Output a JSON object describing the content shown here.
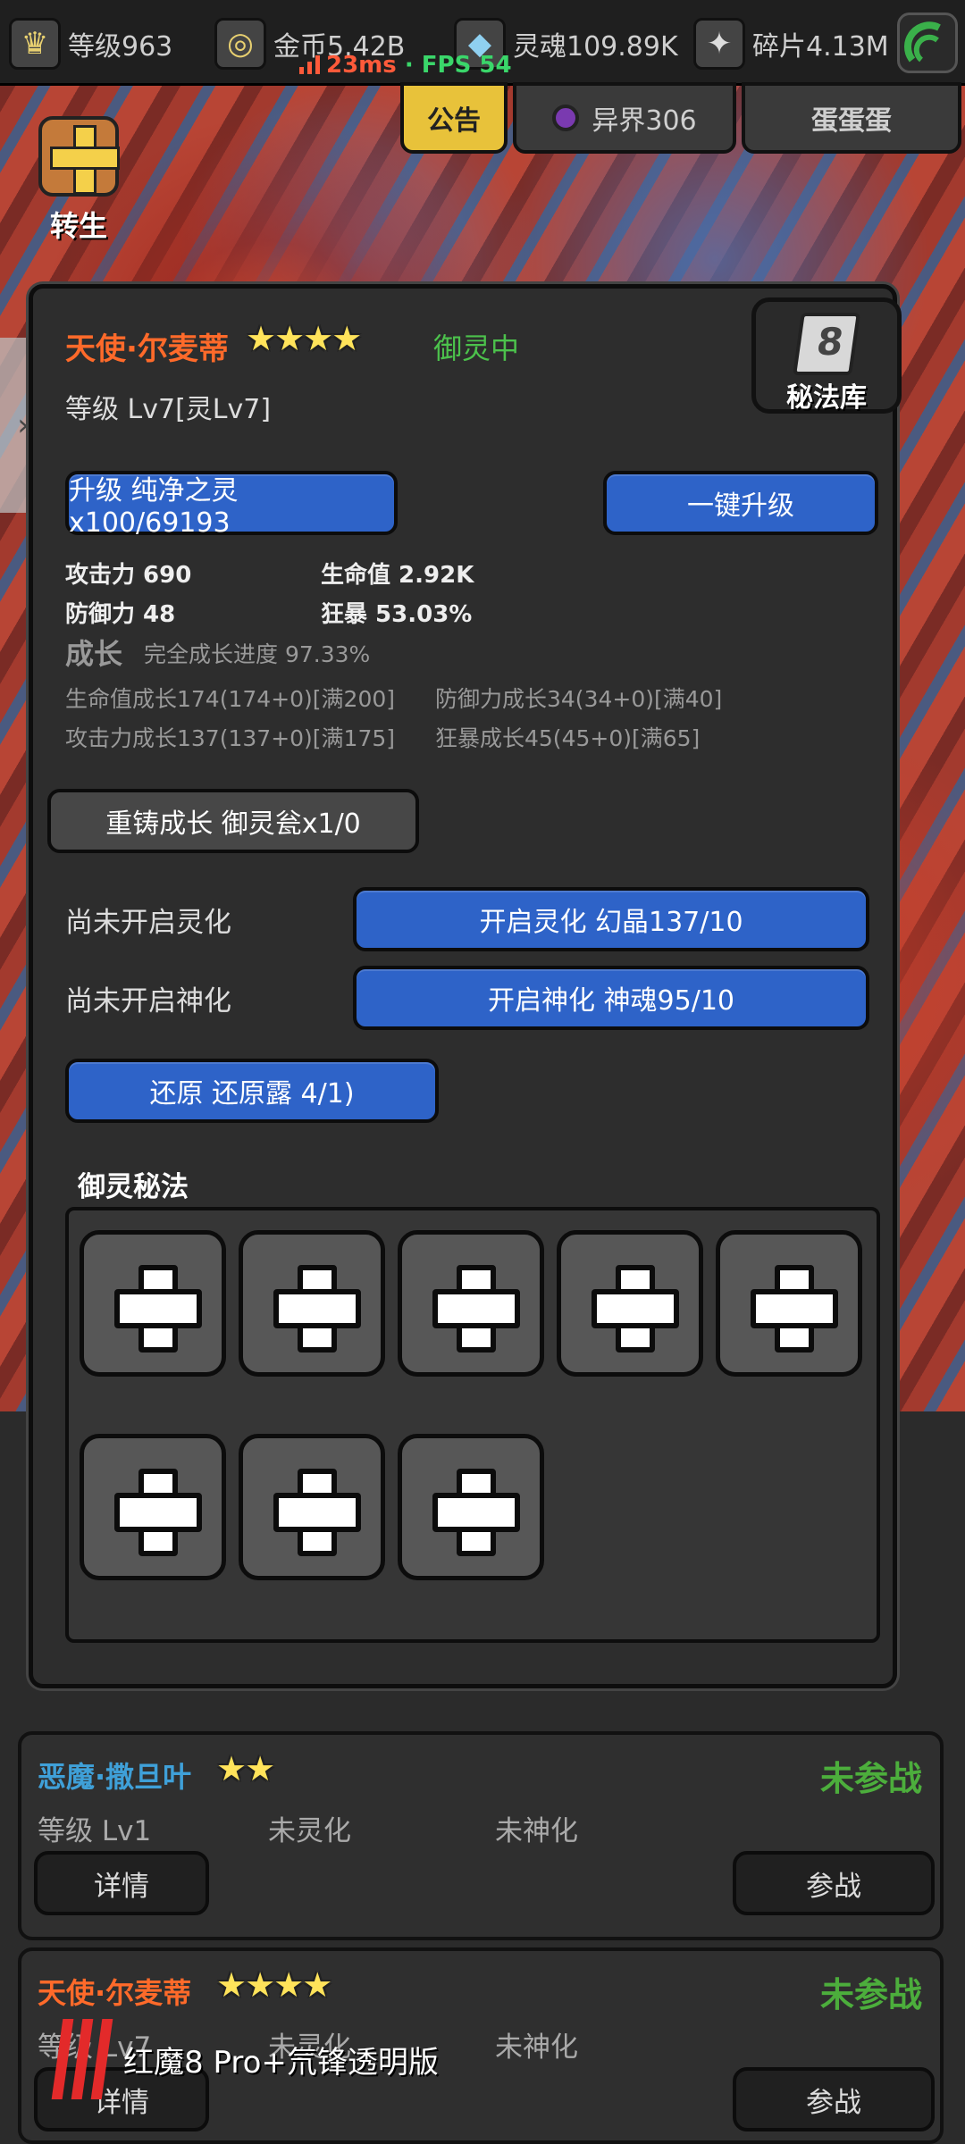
{
  "topbar": {
    "level": "等级963",
    "gold": "金币5.42B",
    "soul": "灵魂109.89K",
    "shard": "碎片4.13M",
    "latency": "23ms",
    "fps_sep": "·",
    "fps": "FPS 54"
  },
  "header": {
    "notice": "公告",
    "otherworld": "异界306",
    "egg": "蛋蛋蛋"
  },
  "side": {
    "rebirth": "转生",
    "handle": "›"
  },
  "panel": {
    "hero_name": "天使·尔麦蒂",
    "hero_stars": 4,
    "status": "御灵中",
    "secret_library": "秘法库",
    "level": "等级 Lv7[灵Lv7]",
    "upgrade_button": "升级 纯净之灵x100/69193",
    "onekey_button": "一键升级",
    "stats": {
      "attack": "攻击力 690",
      "hp": "生命值 2.92K",
      "defense": "防御力 48",
      "crit": "狂暴 53.03%"
    },
    "growth": {
      "title": "成长",
      "progress": "完全成长进度 97.33%",
      "hp_growth": "生命值成长174(174+0)[满200]",
      "def_growth": "防御力成长34(34+0)[满40]",
      "atk_growth": "攻击力成长137(137+0)[满175]",
      "crit_growth": "狂暴成长45(45+0)[满65]"
    },
    "reforge_button": "重铸成长 御灵瓮x1/0",
    "spirit": {
      "label": "尚未开启灵化",
      "button": "开启灵化 幻晶137/10"
    },
    "divine": {
      "label": "尚未开启神化",
      "button": "开启神化 神魂95/10"
    },
    "restore_button": "还原 还原露 4/1)",
    "secret_title": "御灵秘法",
    "slot_count": 8
  },
  "cards": [
    {
      "name": "恶魔·撒旦叶",
      "name_color": "#3fa0d8",
      "stars": 2,
      "state": "未参战",
      "level": "等级 Lv1",
      "spirit": "未灵化",
      "divine": "未神化",
      "detail_button": "详情",
      "join_button": "参战"
    },
    {
      "name": "天使·尔麦蒂",
      "name_color": "#ff6a2a",
      "stars": 4,
      "state": "未参战",
      "level": "等级 Lv7",
      "spirit": "未灵化",
      "divine": "未神化",
      "detail_button": "详情",
      "join_button": "参战"
    }
  ],
  "watermark": "红魔8 Pro+氘锋透明版",
  "colors": {
    "accent_blue": "#2e63c8",
    "hero_orange": "#ff6a2a",
    "status_green": "#4cc24c",
    "star_yellow": "#ffe35a"
  }
}
